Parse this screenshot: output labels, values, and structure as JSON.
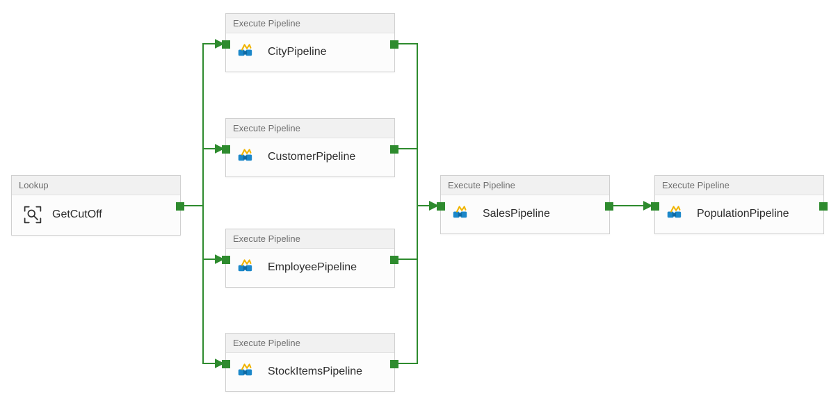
{
  "colors": {
    "connector": "#2e8b2e",
    "arrowhead": "#2e8b2e",
    "header_bg": "#f1f1f1",
    "border": "#d0d0d0",
    "text_muted": "#6e6e6e"
  },
  "activities": {
    "getcutoff": {
      "type_label": "Lookup",
      "name": "GetCutOff"
    },
    "city": {
      "type_label": "Execute Pipeline",
      "name": "CityPipeline"
    },
    "customer": {
      "type_label": "Execute Pipeline",
      "name": "CustomerPipeline"
    },
    "employee": {
      "type_label": "Execute Pipeline",
      "name": "EmployeePipeline"
    },
    "stockitems": {
      "type_label": "Execute Pipeline",
      "name": "StockItemsPipeline"
    },
    "sales": {
      "type_label": "Execute Pipeline",
      "name": "SalesPipeline"
    },
    "population": {
      "type_label": "Execute Pipeline",
      "name": "PopulationPipeline"
    }
  },
  "connections": [
    {
      "from": "getcutoff",
      "to": "city"
    },
    {
      "from": "getcutoff",
      "to": "customer"
    },
    {
      "from": "getcutoff",
      "to": "employee"
    },
    {
      "from": "getcutoff",
      "to": "stockitems"
    },
    {
      "from": "city",
      "to": "sales"
    },
    {
      "from": "customer",
      "to": "sales"
    },
    {
      "from": "employee",
      "to": "sales"
    },
    {
      "from": "stockitems",
      "to": "sales"
    },
    {
      "from": "sales",
      "to": "population"
    }
  ]
}
